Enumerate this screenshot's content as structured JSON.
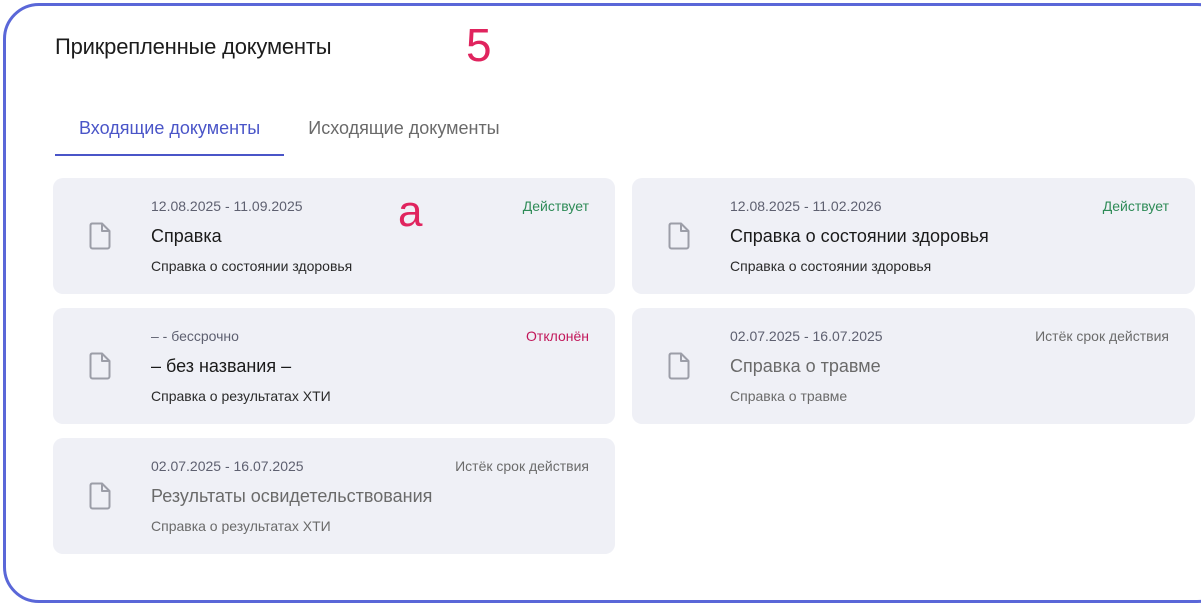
{
  "header": {
    "title": "Прикрепленные документы",
    "annotation_number": "5",
    "annotation_letter": "a"
  },
  "tabs": [
    {
      "label": "Входящие документы",
      "active": true
    },
    {
      "label": "Исходящие документы",
      "active": false
    }
  ],
  "documents": [
    {
      "dates": "12.08.2025 - 11.09.2025",
      "status": "Действует",
      "name": "Справка",
      "type": "Справка о состоянии здоровья"
    },
    {
      "dates": "12.08.2025 - 11.02.2026",
      "status": "Действует",
      "name": "Справка о состоянии здоровья",
      "type": "Справка о состоянии здоровья"
    },
    {
      "dates": "– - бессрочно",
      "status": "Отклонён",
      "name": "– без названия –",
      "type": "Справка о результатах ХТИ"
    },
    {
      "dates": "02.07.2025 - 16.07.2025",
      "status": "Истёк срок действия",
      "name": "Справка о травме",
      "type": "Справка о травме"
    },
    {
      "dates": "02.07.2025 - 16.07.2025",
      "status": "Истёк срок действия",
      "name": "Результаты освидетельствования",
      "type": "Справка о результатах ХТИ"
    }
  ],
  "icons": {
    "document": "document-icon"
  },
  "colors": {
    "frame_border": "#5a67d8",
    "tab_active": "#4a55c8",
    "status_active": "#2e8b57",
    "status_rejected": "#c2185b",
    "status_expired": "#6b6b6b",
    "annotation": "#e0245e",
    "card_background": "#eff0f6"
  }
}
